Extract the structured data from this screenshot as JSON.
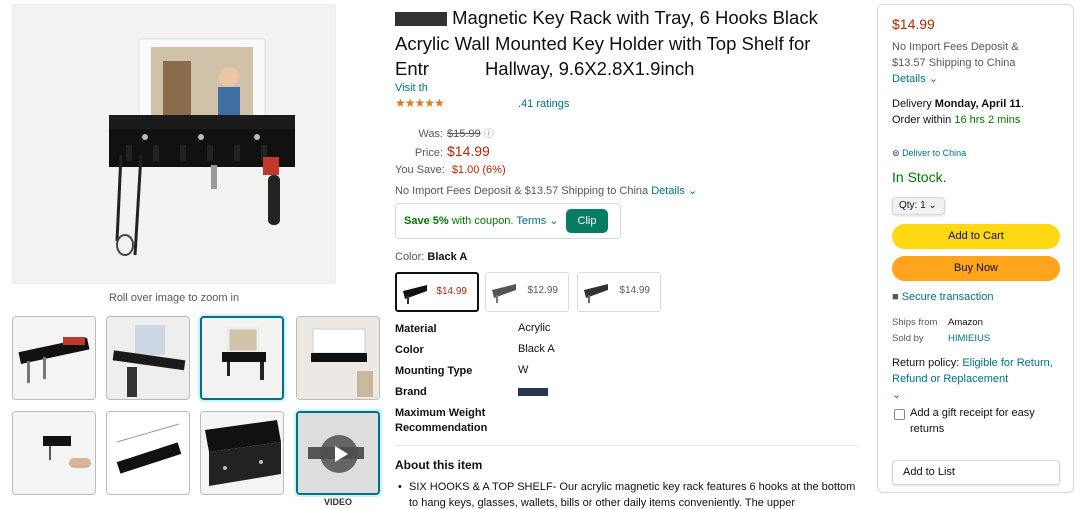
{
  "gallery": {
    "zoom_hint": "Roll over image to zoom in",
    "video_label": "VIDEO"
  },
  "product": {
    "title": "Magnetic Key Rack with Tray, 6 Hooks Black Acrylic Wall Mounted Key Holder with Top Shelf for Entryway Hallway, 9.6X2.8X1.9inch",
    "title_line1": "Magnetic Key Rack with Tray, 6 Hooks Black",
    "title_line2": "Acrylic Wall Mounted Key Holder with Top Shelf for",
    "title_line3_a": "Entr",
    "title_line3_b": "Hallway, 9.6X2.8X1.9inch",
    "visit_prefix": "Visit th",
    "ratings_suffix": ".41 ratings",
    "stars": "★★★★★"
  },
  "pricing": {
    "was_label": "Was:",
    "was_value": "$15.99",
    "price_label": "Price:",
    "price_value": "$14.99",
    "save_label": "You Save:",
    "save_value": "$1.00 (6%)",
    "shipping_prefix": "No Import Fees Deposit & $13.57 Shipping to China",
    "shipping_details": "Details"
  },
  "coupon": {
    "bold": "Save 5%",
    "text": "with coupon.",
    "terms": "Terms",
    "clip": "Clip"
  },
  "color": {
    "label": "Color:",
    "selected": "Black A",
    "swatches": [
      {
        "price": "$14.99"
      },
      {
        "price": "$12.99"
      },
      {
        "price": "$14.99"
      }
    ]
  },
  "specs": [
    {
      "key": "Material",
      "value": "Acrylic"
    },
    {
      "key": "Color",
      "value": "Black A"
    },
    {
      "key": "Mounting Type",
      "value": "W"
    },
    {
      "key": "Brand",
      "value": ""
    },
    {
      "key": "Maximum Weight Recommendation",
      "value": ""
    }
  ],
  "about": {
    "title": "About this item",
    "item1": "SIX HOOKS & A TOP SHELF- Our acrylic magnetic key rack features 6 hooks at the bottom to hang keys, glasses, wallets, bills or other daily items conveniently. The upper"
  },
  "buybox": {
    "price": "$14.99",
    "fees_line1": "No Import Fees Deposit &",
    "fees_line2": "$13.57 Shipping to China",
    "details": "Details",
    "delivery_prefix": "Delivery",
    "delivery_date": "Monday, April 11",
    "order_within_prefix": "Order within",
    "order_within_time": "16 hrs 2 mins",
    "deliver_to": "Deliver to China",
    "stock": "In Stock.",
    "qty": "Qty: 1",
    "add_to_cart": "Add to Cart",
    "buy_now": "Buy Now",
    "secure": "Secure transaction",
    "ships_from_label": "Ships from",
    "ships_from_value": "Amazon",
    "sold_by_label": "Sold by",
    "sold_by_value": "HIMIEIUS",
    "return_prefix": "Return policy:",
    "return_link": "Eligible for Return, Refund or Replacement",
    "gift": "Add a gift receipt for easy returns",
    "add_to_list": "Add to List"
  },
  "colors": {
    "link": "#007185",
    "price_red": "#b12704",
    "in_stock_green": "#007600",
    "cart_yellow": "#ffd814",
    "buy_orange": "#ffa41c",
    "clip_green": "#067d62"
  }
}
